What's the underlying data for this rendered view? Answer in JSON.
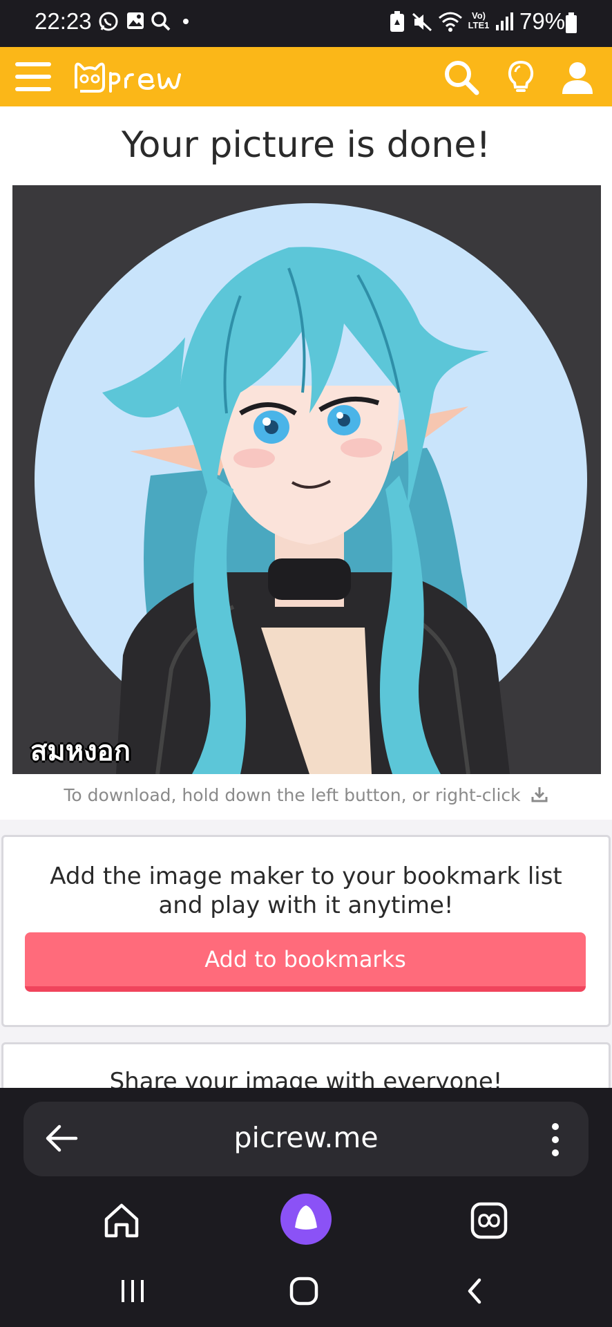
{
  "status_bar": {
    "time": "22:23",
    "battery_percent": "79%",
    "icons": [
      "whatsapp-icon",
      "gallery-icon",
      "search-icon",
      "dot-icon",
      "battery-saver-icon",
      "mute-icon",
      "wifi-icon",
      "volte-icon",
      "signal-icon",
      "battery-icon"
    ],
    "volte_label": "Vo)\nLTE1"
  },
  "header": {
    "brand": "Picrew",
    "icons": [
      "menu-icon",
      "search-icon",
      "lightbulb-icon",
      "user-icon"
    ],
    "color": "#fbb718"
  },
  "main": {
    "title": "Your picture is done!",
    "picture_signature": "สมหงอก",
    "download_caption": "To download, hold down the left button, or right-click",
    "download_icon": "download-icon"
  },
  "bookmark_card": {
    "message": "Add the image maker to your bookmark list and play with it anytime!",
    "button_label": "Add to bookmarks",
    "button_color": "#ff6b7b"
  },
  "share_card": {
    "message": "Share your image with everyone!"
  },
  "browser": {
    "url": "picrew.me",
    "icons": [
      "back-arrow-icon",
      "more-vert-icon",
      "home-icon",
      "assistant-icon",
      "tabs-icon"
    ]
  },
  "system_nav": {
    "icons": [
      "recents-icon",
      "home-circle-icon",
      "back-chevron-icon"
    ]
  }
}
